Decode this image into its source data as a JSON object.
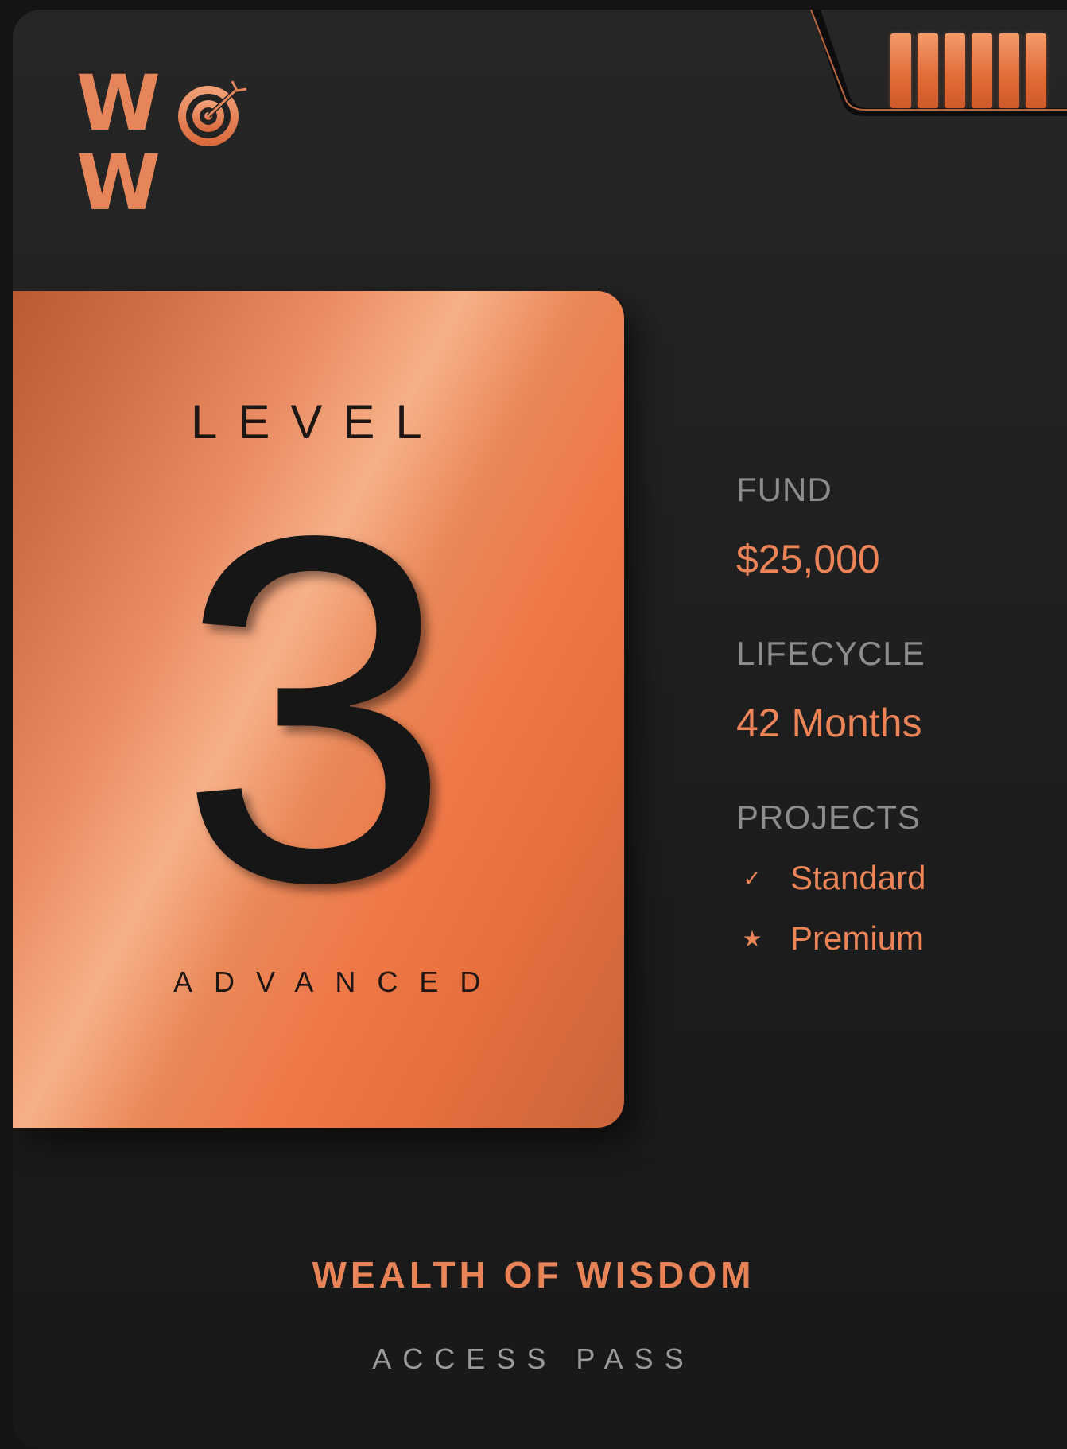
{
  "brand": {
    "logo_text_left": "W",
    "logo_text_right": "W",
    "logo_icon": "target-icon"
  },
  "indicator": {
    "icon": "battery-icon",
    "segments": 6,
    "filled": 6
  },
  "level_card": {
    "label": "LEVEL",
    "number": "3",
    "tier": "ADVANCED"
  },
  "details": {
    "fund_label": "FUND",
    "fund_value": "$25,000",
    "lifecycle_label": "LIFECYCLE",
    "lifecycle_value": "42 Months",
    "projects_label": "PROJECTS",
    "projects": [
      {
        "icon": "check-icon",
        "label": "Standard"
      },
      {
        "icon": "star-icon",
        "label": "Premium"
      }
    ]
  },
  "footer": {
    "title": "WEALTH OF WISDOM",
    "subtitle": "ACCESS PASS"
  },
  "colors": {
    "accent": "#ec8458",
    "background": "#1d1d1d",
    "muted_text": "#8c8c8c"
  }
}
